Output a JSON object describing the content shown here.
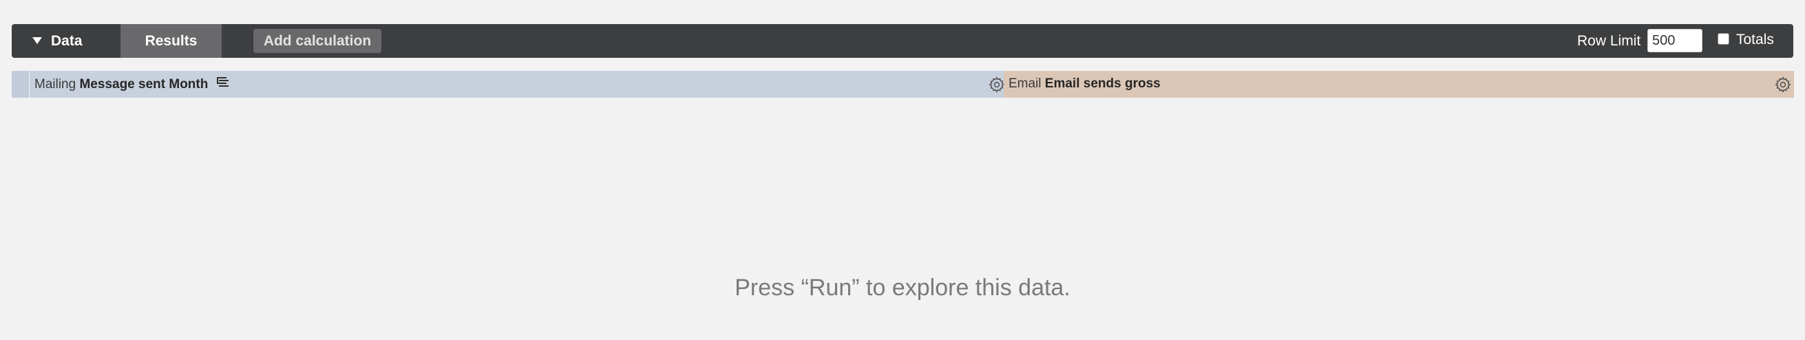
{
  "toolbar": {
    "data_tab_label": "Data",
    "results_tab_label": "Results",
    "add_calculation_label": "Add calculation",
    "row_limit_label": "Row Limit",
    "row_limit_value": "500",
    "totals_label": "Totals",
    "totals_checked": false
  },
  "columns": [
    {
      "view": "Mailing",
      "field": "Message sent Month",
      "pivoted": true,
      "color": "#c8d0dd"
    },
    {
      "view": "Email",
      "field": "Email sends gross",
      "pivoted": false,
      "color": "#dcc7b6"
    }
  ],
  "results": {
    "empty_message": "Press “Run” to explore this data."
  },
  "colors": {
    "toolbar_bg": "#3d3e40",
    "active_tab_bg": "#69696b",
    "dimension_header": "#c8d0dd",
    "measure_header": "#dcc7b6",
    "page_bg": "#f2f2f2"
  },
  "icons": {
    "collapse": "caret-down-icon",
    "pivot": "pivot-icon",
    "settings": "gear-icon"
  }
}
